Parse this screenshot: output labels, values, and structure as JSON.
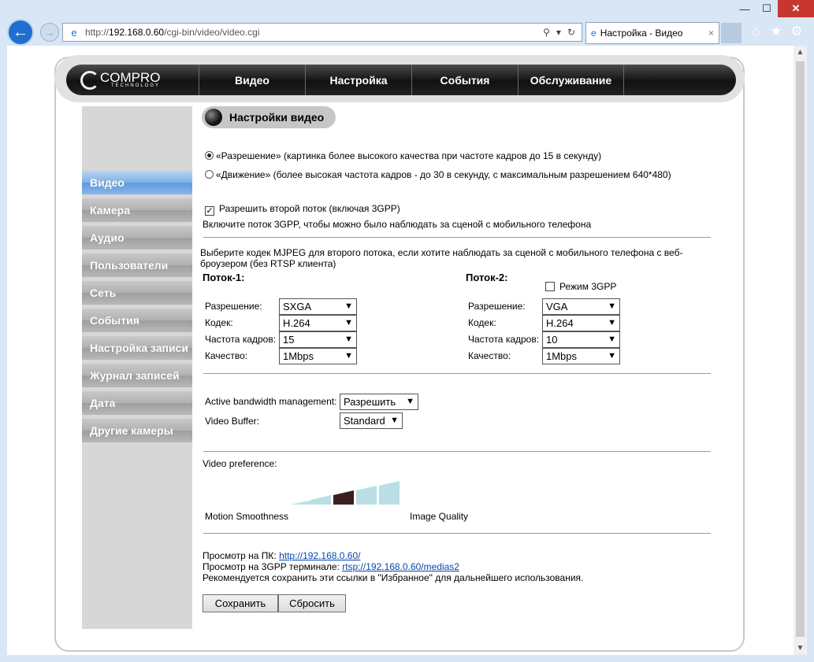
{
  "browser": {
    "url_prefix": "http://",
    "url_host": "192.168.0.60",
    "url_path": "/cgi-bin/video/video.cgi",
    "tab_title": "Настройка - Видео",
    "tab_close": "×",
    "win_min": "—",
    "win_max": "☐",
    "win_close": "✕"
  },
  "topnav": {
    "brand": "COMPRO",
    "brand_sub": "TECHNOLOGY",
    "items": [
      "Видео",
      "Настройка",
      "События",
      "Обслуживание"
    ]
  },
  "sidebar": {
    "items": [
      "Видео",
      "Камера",
      "Аудио",
      "Пользователи",
      "Сеть",
      "События",
      "Настройка записи",
      "Журнал записей",
      "Дата",
      "Другие камеры"
    ],
    "active_index": 0
  },
  "page": {
    "title": "Настройки видео",
    "mode_resolution": "«Разрешение» (картинка более высокого качества при частоте кадров до 15 в секунду)",
    "mode_motion": "«Движение» (более высокая частота кадров - до 30 в секунду, с максимальным разрешением 640*480)",
    "second_stream_label": "Разрешить второй поток (включая 3GPP)",
    "second_stream_hint": "Включите поток 3GPP, чтобы можно было наблюдать за сценой с мобильного телефона",
    "mjpeg_hint_1": "Выберите кодек MJPEG для второго потока, если хотите наблюдать за сценой с мобильного телефона с веб-",
    "mjpeg_hint_2": "броузером (без RTSP клиента)",
    "stream1": {
      "title": "Поток-1:",
      "labels": [
        "Разрешение:",
        "Кодек:",
        "Частота кадров:",
        "Качество:"
      ],
      "values": [
        "SXGA",
        "H.264",
        "15",
        "1Mbps"
      ]
    },
    "stream2": {
      "title": "Поток-2:",
      "mode_3gpp": "Режим 3GPP",
      "labels": [
        "Разрешение:",
        "Кодек:",
        "Частота кадров:",
        "Качество:"
      ],
      "values": [
        "VGA",
        "H.264",
        "10",
        "1Mbps"
      ]
    },
    "abm_label": "Active bandwidth management:",
    "abm_value": "Разрешить",
    "buffer_label": "Video Buffer:",
    "buffer_value": "Standard",
    "pref_label": "Video preference:",
    "pref_left": "Motion Smoothness",
    "pref_right": "Image Quality",
    "pref_selected": 3,
    "pref_levels": 5,
    "view_pc_label": "Просмотр на ПК: ",
    "view_pc_link": "http://192.168.0.60/",
    "view_3gpp_label": "Просмотр на 3GPP терминале: ",
    "view_3gpp_link": "rtsp://192.168.0.60/medias2",
    "bookmark_hint": "Рекомендуется сохранить эти ссылки в \"Избранное\" для дальнейшего использования.",
    "save_label": "Сохранить",
    "reset_label": "Сбросить"
  },
  "colors": {
    "pref_bar": "#b9dfe4",
    "pref_bar_selected": "#3b1f1f",
    "active_side": "#6ea5e3"
  }
}
